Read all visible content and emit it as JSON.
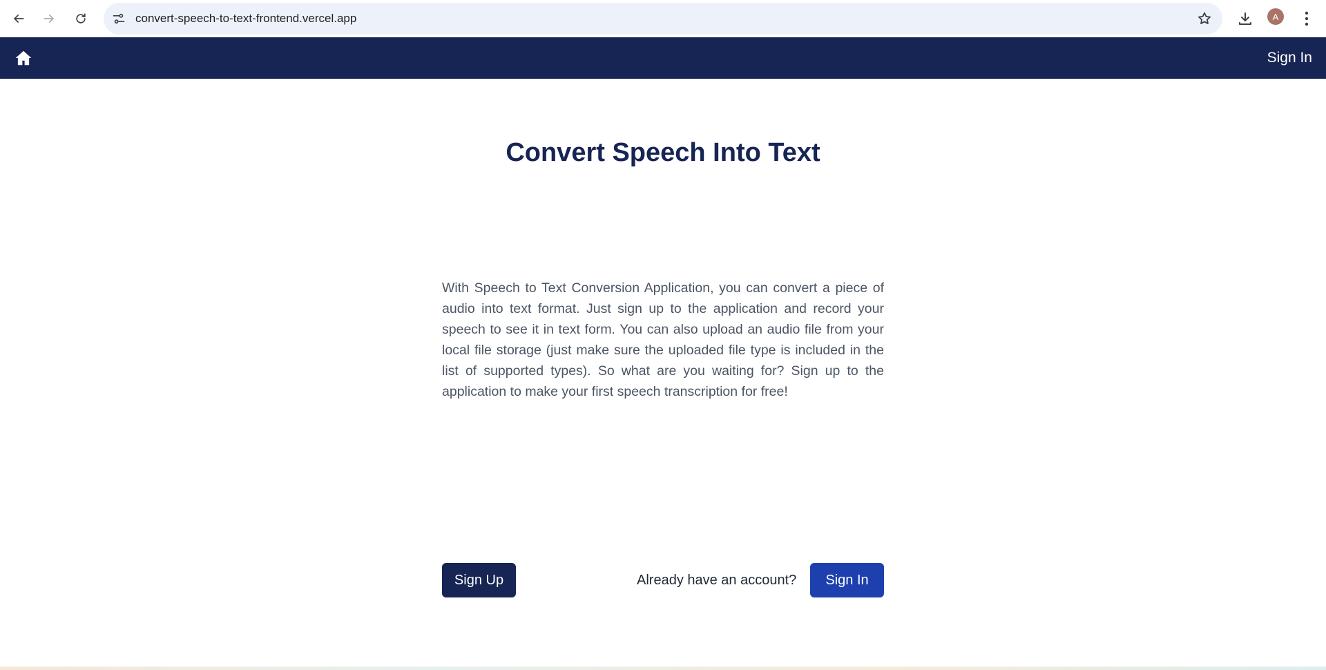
{
  "browser": {
    "url": "convert-speech-to-text-frontend.vercel.app",
    "profile_initial": "A"
  },
  "navbar": {
    "signin_label": "Sign In"
  },
  "main": {
    "title": "Convert Speech Into Text",
    "description": "With Speech to Text Conversion Application, you can convert a piece of audio into text format. Just sign up to the application and record your speech to see it in text form. You can also upload an audio file from your local file storage (just make sure the uploaded file type is included in the list of supported types). So what are you waiting for? Sign up to the application to make your first speech transcription for free!",
    "signup_label": "Sign Up",
    "account_prompt": "Already have an account?",
    "signin_label": "Sign In"
  },
  "colors": {
    "navbar_bg": "#172554",
    "signup_bg": "#172554",
    "signin_bg": "#1e40af",
    "title": "#172554"
  },
  "icons": [
    "back-arrow-icon",
    "forward-arrow-icon",
    "reload-icon",
    "site-info-icon",
    "bookmark-star-icon",
    "download-icon",
    "menu-dots-icon",
    "home-icon"
  ]
}
